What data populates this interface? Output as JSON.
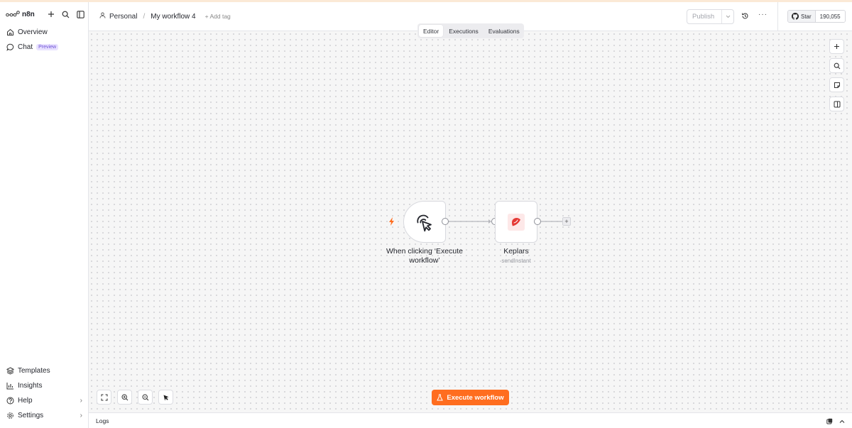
{
  "app": {
    "logo_text": "n8n"
  },
  "sidebar": {
    "top_items": [
      {
        "label": "Overview",
        "icon": "home-icon"
      },
      {
        "label": "Chat",
        "icon": "chat-icon",
        "badge": "Preview"
      }
    ],
    "bottom_items": [
      {
        "label": "Templates",
        "icon": "templates-icon"
      },
      {
        "label": "Insights",
        "icon": "insights-icon"
      },
      {
        "label": "Help",
        "icon": "help-icon"
      },
      {
        "label": "Settings",
        "icon": "gear-icon"
      }
    ]
  },
  "header": {
    "project": "Personal",
    "workflow_name": "My workflow 4",
    "add_tag": "+ Add tag",
    "publish_label": "Publish",
    "github": {
      "star_label": "Star",
      "count": "190,055"
    }
  },
  "tabs": [
    {
      "label": "Editor",
      "active": true
    },
    {
      "label": "Executions",
      "active": false
    },
    {
      "label": "Evaluations",
      "active": false
    }
  ],
  "nodes": {
    "trigger": {
      "label": "When clicking ‘Execute workflow’"
    },
    "keplars": {
      "label": "Keplars",
      "sublabel": "sendInstant"
    }
  },
  "execute_button": {
    "label": "Execute workflow"
  },
  "logs": {
    "label": "Logs"
  },
  "colors": {
    "accent": "#ff6d1f",
    "preview_badge": "#e9e2ff",
    "keplars_red": "#e53935"
  }
}
